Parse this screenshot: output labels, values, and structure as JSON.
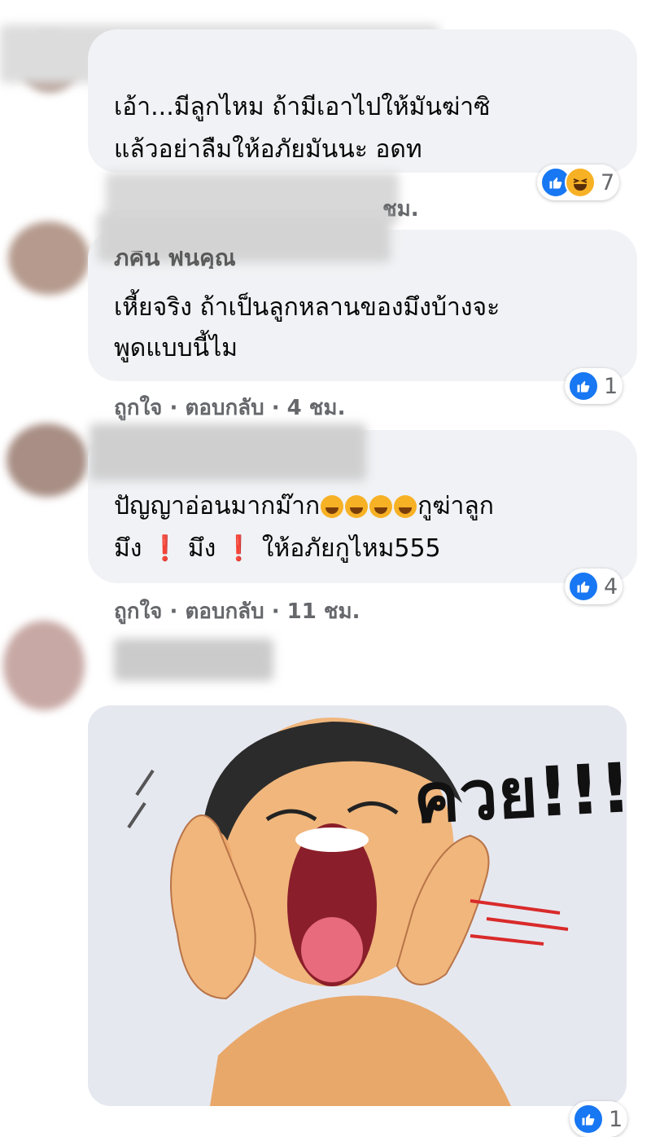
{
  "comments": [
    {
      "text_lines": [
        "เอ้า...มีลูกไหม ถ้ามีเอาไปให้มันฆ่าซิ",
        "แล้วอย่าลืมให้อภัยมันนะ อดท"
      ],
      "meta_time_fragment": "ชม.",
      "reaction_count": "7"
    },
    {
      "name_fragment": "ภคิน ฟนคุณ",
      "text_lines": [
        "เหี้ยจริง ถ้าเป็นลูกหลานของมึงบ้างจะ",
        "พูดแบบนี้ไม"
      ],
      "like": "ถูกใจ",
      "sep": "·",
      "reply": "ตอบกลับ",
      "time": "4 ชม.",
      "reaction_count": "1"
    },
    {
      "text_line1": "ปัญญาอ่อนมากม๊าก",
      "text_line1_tail": "กูฆ่าลูก",
      "text_line2_a": "มึง",
      "text_line2_b": "มึง",
      "text_line2_c": "ให้อภัยกูไหม555",
      "excl": "❗",
      "like": "ถูกใจ",
      "sep": "·",
      "reply": "ตอบกลับ",
      "time": "11 ชม.",
      "reaction_count": "4"
    },
    {
      "sticker_text": "ควย!!!",
      "reaction_count": "1"
    }
  ],
  "colors": {
    "bubble": "#f0f2f5",
    "meta_text": "#65676b",
    "like_blue": "#1877f2",
    "haha_yellow": "#f7b125"
  },
  "icons": [
    "like-icon",
    "haha-icon",
    "rolling-laugh-emoji",
    "tears-of-joy-emoji",
    "exclamation-emoji"
  ]
}
